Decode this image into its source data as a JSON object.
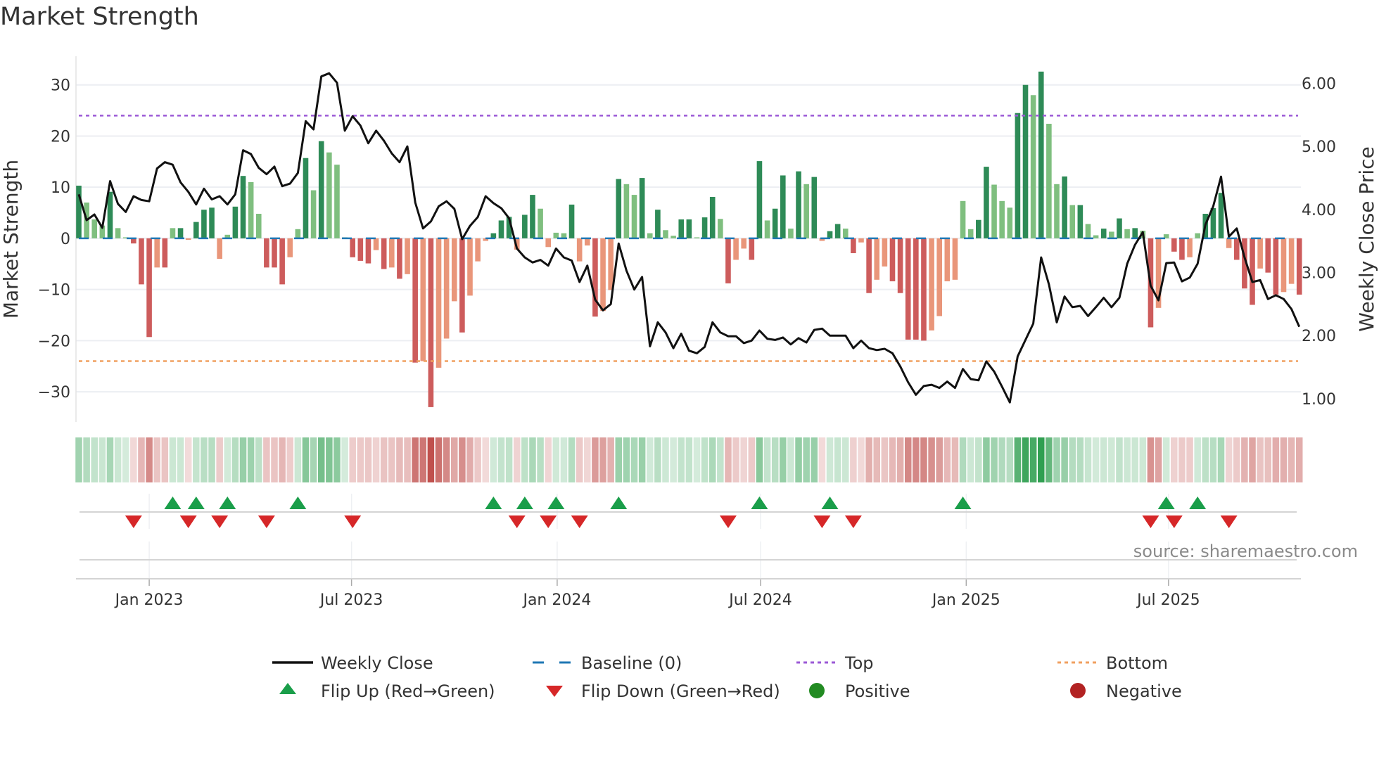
{
  "title": "Market Strength",
  "source": "source: sharemaestro.com",
  "chart_data": {
    "type": "bar+line",
    "title": "Market Strength",
    "x_start": "2022-10-30",
    "x_interval": "weekly",
    "ylabel_left": "Market Strength",
    "ylabel_right": "Weekly Close Price",
    "ylim_left": [
      -35.9,
      35.6
    ],
    "ylim_right": [
      0.63,
      6.43
    ],
    "yticks_left": [
      30,
      20,
      10,
      0,
      -10,
      -20,
      -30
    ],
    "yticks_left_labels": [
      "30",
      "20",
      "10",
      "0",
      "−10",
      "−20",
      "−30"
    ],
    "yticks_right": [
      6,
      5,
      4,
      3,
      2,
      1
    ],
    "yticks_right_labels": [
      "6.00",
      "5.00",
      "4.00",
      "3.00",
      "2.00",
      "1.00"
    ],
    "xticks": [
      {
        "label": "Jan 2023",
        "date": "2023-01-01"
      },
      {
        "label": "Jul 2023",
        "date": "2023-07-01"
      },
      {
        "label": "Jan 2024",
        "date": "2024-01-01"
      },
      {
        "label": "Jul 2024",
        "date": "2024-07-01"
      },
      {
        "label": "Jan 2025",
        "date": "2025-01-01"
      },
      {
        "label": "Jul 2025",
        "date": "2025-07-01"
      }
    ],
    "grid": true,
    "top_level": 24,
    "bottom_level": -24,
    "baseline": 0,
    "strength": [
      10.3,
      7,
      3.7,
      2.5,
      9.1,
      2,
      0.2,
      -1,
      -9,
      -19.3,
      -5.7,
      -5.7,
      2,
      2,
      -0.3,
      3.2,
      5.6,
      6,
      -4,
      0.7,
      6.2,
      12.2,
      11,
      4.8,
      -5.7,
      -5.7,
      -9,
      -3.7,
      1.8,
      15.7,
      9.4,
      19,
      16.8,
      14.4,
      0.2,
      -3.7,
      -4.4,
      -4.9,
      -2.3,
      -6,
      -5.7,
      -7.9,
      -7,
      -24.3,
      -24,
      -33,
      -25.3,
      -19.6,
      -12.3,
      -18.4,
      -11.2,
      -4.5,
      -0.5,
      1,
      3.5,
      4.2,
      -2.2,
      4.6,
      8.5,
      5.8,
      -1.7,
      1.1,
      1,
      6.6,
      -4.5,
      -1.4,
      -15.3,
      -14.2,
      -10.1,
      11.6,
      10.6,
      8.5,
      11.8,
      1,
      5.6,
      1.6,
      0.5,
      3.7,
      3.7,
      0.2,
      4.1,
      8.1,
      3.8,
      -8.8,
      -4.2,
      -2,
      -4.2,
      15.1,
      3.5,
      5.8,
      12.3,
      1.9,
      13.1,
      10.6,
      12,
      -0.5,
      1.4,
      2.8,
      1.9,
      -2.9,
      -0.8,
      -10.7,
      -8.1,
      -5.5,
      -8.4,
      -10.7,
      -19.8,
      -19.8,
      -20,
      -18,
      -15.2,
      -8.4,
      -8.1,
      7.3,
      1.8,
      3.6,
      14,
      10.5,
      7.3,
      6,
      24.5,
      30,
      28,
      32.6,
      22.4,
      10.6,
      12.1,
      6.5,
      6.5,
      2.8,
      0.6,
      1.9,
      1.3,
      3.9,
      1.8,
      2,
      1.5,
      -17.4,
      -13.6,
      0.8,
      -2.6,
      -4.2,
      -3.7,
      1,
      4.8,
      5.9,
      8.9,
      -1.9,
      -4.2,
      -9.8,
      -13,
      -5.9,
      -6.7,
      -11,
      -10.5,
      -8.9,
      -11
    ],
    "weekly_close": [
      4.24,
      3.83,
      3.92,
      3.71,
      4.45,
      4.09,
      3.96,
      4.21,
      4.15,
      4.13,
      4.65,
      4.75,
      4.71,
      4.43,
      4.28,
      4.08,
      4.33,
      4.16,
      4.21,
      4.08,
      4.24,
      4.94,
      4.88,
      4.66,
      4.56,
      4.68,
      4.37,
      4.41,
      4.58,
      5.4,
      5.27,
      6.11,
      6.16,
      6.01,
      5.25,
      5.48,
      5.33,
      5.05,
      5.25,
      5.09,
      4.89,
      4.75,
      5.0,
      4.11,
      3.7,
      3.81,
      4.05,
      4.13,
      4.01,
      3.53,
      3.74,
      3.88,
      4.21,
      4.1,
      4.02,
      3.86,
      3.38,
      3.24,
      3.16,
      3.2,
      3.11,
      3.38,
      3.24,
      3.19,
      2.85,
      3.11,
      2.57,
      2.4,
      2.5,
      3.46,
      3.03,
      2.73,
      2.93,
      1.83,
      2.21,
      2.05,
      1.8,
      2.03,
      1.76,
      1.72,
      1.82,
      2.21,
      2.05,
      1.99,
      1.99,
      1.88,
      1.92,
      2.08,
      1.95,
      1.93,
      1.97,
      1.86,
      1.96,
      1.89,
      2.09,
      2.11,
      2.0,
      2.0,
      2.0,
      1.8,
      1.92,
      1.8,
      1.77,
      1.79,
      1.72,
      1.51,
      1.26,
      1.06,
      1.2,
      1.22,
      1.17,
      1.27,
      1.17,
      1.47,
      1.31,
      1.29,
      1.59,
      1.43,
      1.19,
      0.94,
      1.67,
      1.93,
      2.19,
      3.24,
      2.81,
      2.21,
      2.62,
      2.45,
      2.47,
      2.31,
      2.45,
      2.6,
      2.45,
      2.6,
      3.14,
      3.44,
      3.64,
      2.79,
      2.56,
      3.15,
      3.16,
      2.86,
      2.92,
      3.14,
      3.76,
      4.05,
      4.52,
      3.57,
      3.7,
      3.24,
      2.85,
      2.88,
      2.58,
      2.64,
      2.58,
      2.42,
      2.14
    ],
    "flip_up_weeks": [
      12,
      15,
      19,
      28,
      53,
      57,
      61,
      69,
      87,
      96,
      113,
      139,
      143
    ],
    "flip_down_weeks": [
      7,
      14,
      18,
      24,
      35,
      56,
      60,
      64,
      83,
      95,
      99,
      137,
      140,
      147
    ],
    "colors": {
      "pos_strong": "#2e8b57",
      "pos_weak": "#7fbf7f",
      "neg_strong": "#cd5c5c",
      "neg_weak": "#e9967a",
      "line": "#111111",
      "baseline": "#1f77b4",
      "top": "#9b59d6",
      "bottom": "#f0a060",
      "flip_up": "#1a9e4a",
      "flip_down": "#d62728",
      "positive": "#228b22",
      "negative": "#b22222",
      "heat_pos": "#2e9e4f",
      "heat_neg": "#c0504d"
    },
    "legend": {
      "placement": "bottom",
      "items": [
        {
          "key": "line",
          "label": "Weekly Close"
        },
        {
          "key": "baseline",
          "label": "Baseline (0)"
        },
        {
          "key": "top",
          "label": "Top"
        },
        {
          "key": "bottom",
          "label": "Bottom"
        },
        {
          "key": "flip_up",
          "label": "Flip Up (Red→Green)"
        },
        {
          "key": "flip_down",
          "label": "Flip Down (Green→Red)"
        },
        {
          "key": "positive",
          "label": "Positive"
        },
        {
          "key": "negative",
          "label": "Negative"
        }
      ]
    }
  }
}
